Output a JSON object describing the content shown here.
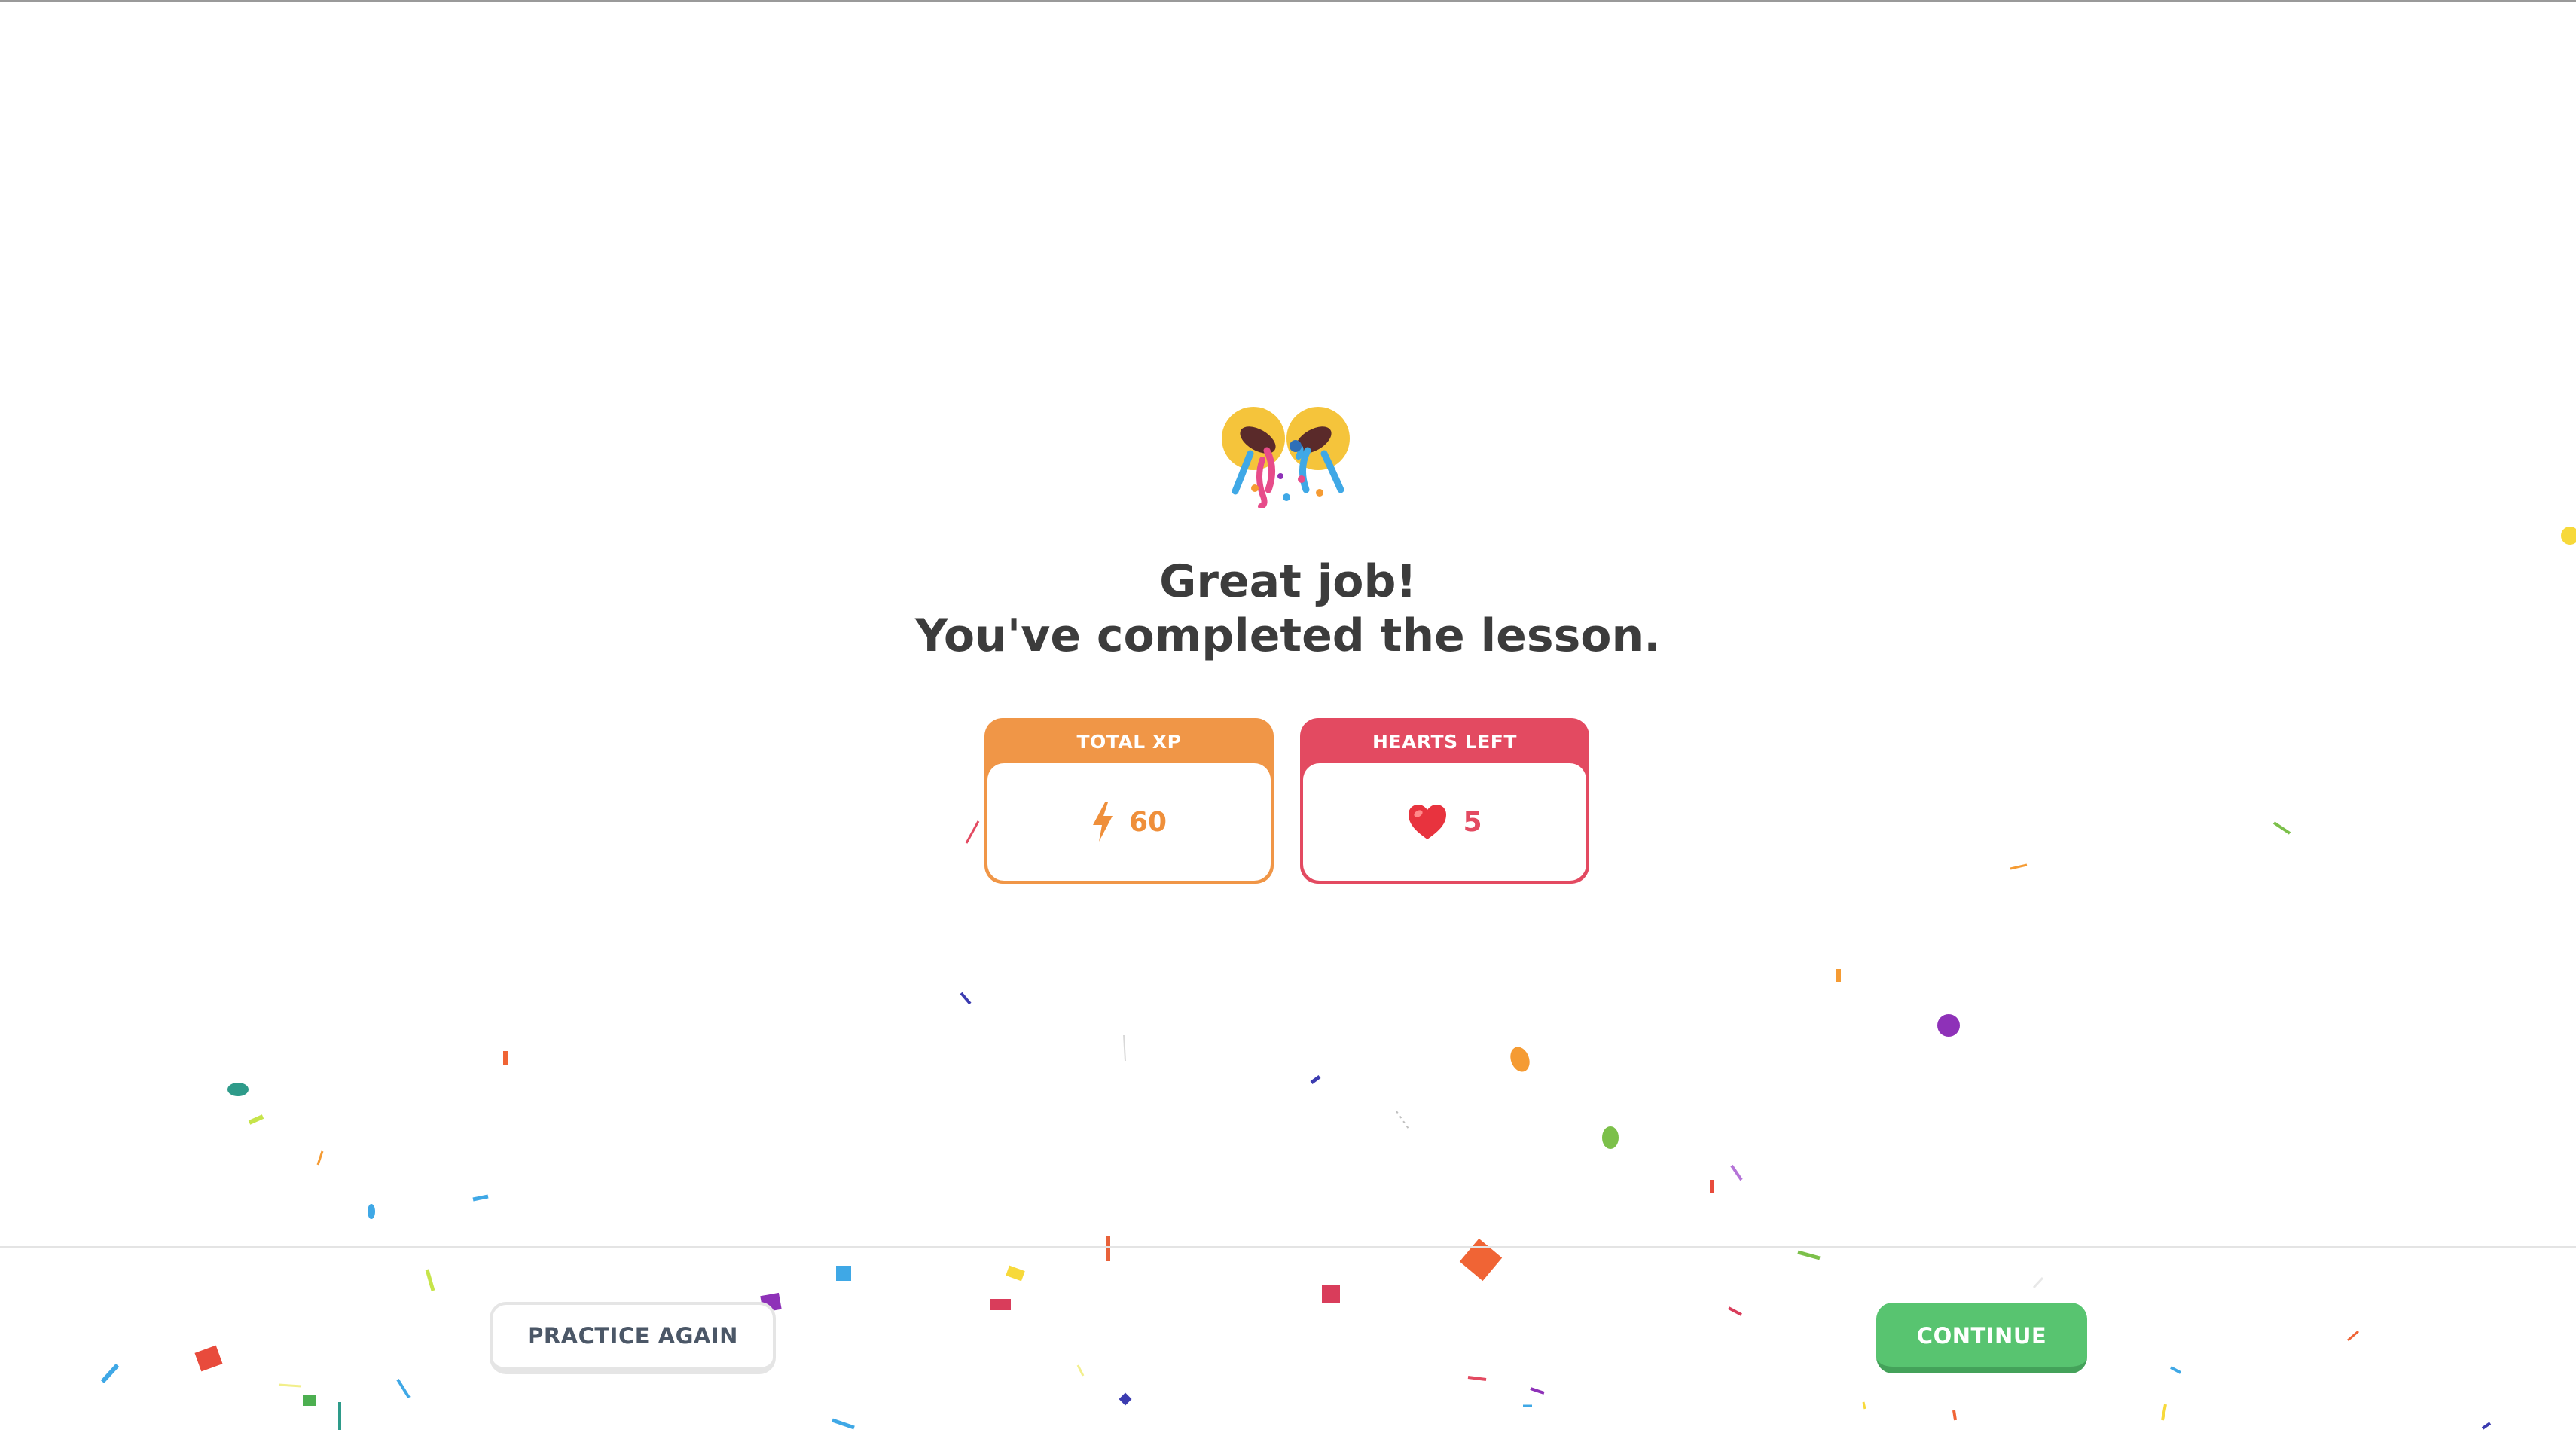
{
  "emoji": "party-popper-emoji",
  "title": {
    "line1": "Great job!",
    "line2": "You've completed the lesson."
  },
  "stats": {
    "xp": {
      "label": "TOTAL XP",
      "value": "60",
      "icon": "lightning-bolt-icon",
      "color": "#f09647"
    },
    "hearts": {
      "label": "HEARTS LEFT",
      "value": "5",
      "icon": "heart-icon",
      "color": "#e34a61"
    }
  },
  "footer": {
    "practice_again": "PRACTICE AGAIN",
    "continue": "CONTINUE"
  },
  "colors": {
    "primary_button": "#58c470",
    "secondary_text": "#4b5767",
    "title_text": "#3c3c3c"
  }
}
